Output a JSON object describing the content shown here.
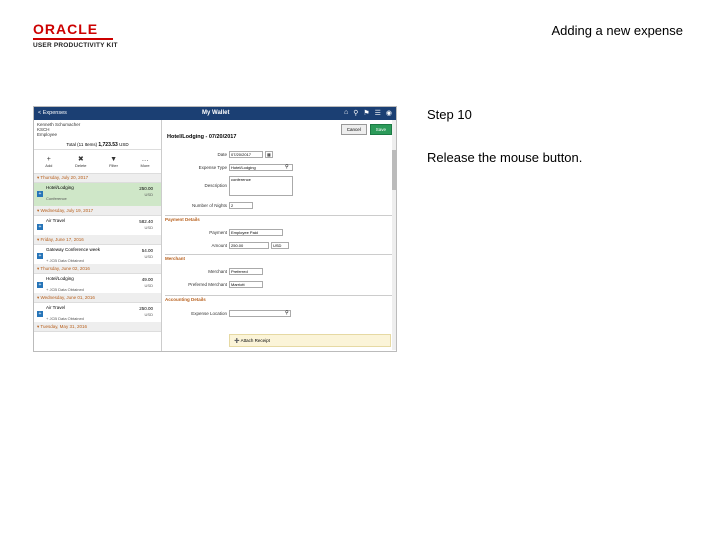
{
  "header": {
    "logo_word": "ORACLE",
    "logo_sub": "USER PRODUCTIVITY KIT",
    "slide_title": "Adding a new expense"
  },
  "step": {
    "label": "Step 10",
    "instruction": "Release the mouse button."
  },
  "app": {
    "back_label": "< Expenses",
    "title": "My Wallet",
    "user_name": "Kenneth Schumacher",
    "user_id": "KSCH",
    "user_role": "Employee",
    "total_label": "Total (11 Items)",
    "total_value": "1,723.53",
    "total_currency": "USD",
    "tools": [
      {
        "label": "Add",
        "icon": "+"
      },
      {
        "label": "Delete",
        "icon": "✖"
      },
      {
        "label": "Filter",
        "icon": "▼"
      },
      {
        "label": "More",
        "icon": "…"
      }
    ],
    "icons": [
      "home-icon",
      "search-icon",
      "flag-icon",
      "menu-icon",
      "compass-icon"
    ],
    "days": [
      {
        "header": "▾ Thursday, July 20, 2017",
        "entries": [
          {
            "title": "Hotel/Lodging",
            "sub": "Conference",
            "amount": "250.00",
            "currency": "USD",
            "selected": true
          }
        ]
      },
      {
        "header": "▾ Wednesday, July 19, 2017",
        "entries": [
          {
            "title": "Air Travel",
            "sub": "",
            "amount": "582.40",
            "currency": "USD",
            "selected": false
          }
        ]
      },
      {
        "header": "▾ Friday, June 17, 2016",
        "entries": [
          {
            "title": "Gateway Conference week",
            "sub": "+ JCB Data Obtained",
            "amount": "54.00",
            "currency": "USD",
            "selected": false
          }
        ]
      },
      {
        "header": "▾ Thursday, June 02, 2016",
        "entries": [
          {
            "title": "Hotel/Lodging",
            "sub": "+ JCB Data Obtained",
            "amount": "49.00",
            "currency": "USD",
            "selected": false
          }
        ]
      },
      {
        "header": "▾ Wednesday, June 01, 2016",
        "entries": [
          {
            "title": "Air Travel",
            "sub": "+ JCB Data Obtained",
            "amount": "250.00",
            "currency": "USD",
            "selected": false
          }
        ]
      },
      {
        "header": "▾ Tuesday, May 31, 2016",
        "entries": []
      }
    ],
    "buttons": {
      "cancel": "Cancel",
      "save": "Save"
    },
    "form": {
      "title": "Hotel/Lodging - 07/20/2017",
      "date_label": "Date",
      "date_value": "07/20/2017",
      "expense_type_label": "Expense Type",
      "expense_type_value": "Hotel/Lodging",
      "description_label": "Description",
      "description_value": "conference",
      "nights_label": "Number of Nights",
      "nights_value": "2",
      "payment_section": "Payment Details",
      "payment_label": "Payment",
      "payment_value": "Employee Paid",
      "amount_label": "Amount",
      "amount_value": "250.00",
      "amount_currency": "USD",
      "merchant_section": "Merchant",
      "merchant_label": "Merchant",
      "merchant_value": "Preferred",
      "preferred_merchant_label": "Preferred Merchant",
      "preferred_merchant_value": "Marriott",
      "accounting_section": "Accounting Details",
      "expense_location_label": "Expense Location",
      "attach_label": "Attach Receipt"
    }
  }
}
